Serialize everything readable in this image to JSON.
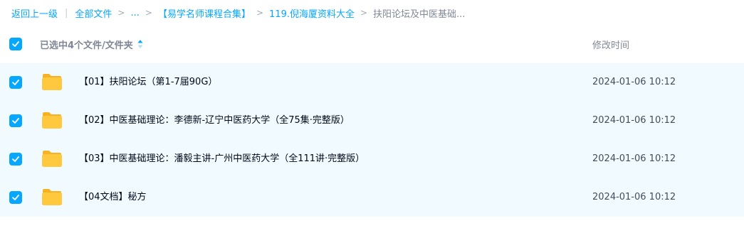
{
  "breadcrumb": {
    "back": "返回上一级",
    "all_files": "全部文件",
    "ellipsis": "...",
    "collection": "【易学名师课程合集】",
    "folder": "119.倪海厦资料大全",
    "current": "扶阳论坛及中医基础..."
  },
  "header": {
    "selection_label": "已选中4个文件/文件夹",
    "time_label": "修改时间",
    "sort_icon": "sort-arrows-icon",
    "checkbox_icon": "checkmark-icon"
  },
  "rows": [
    {
      "name": "【01】扶阳论坛（第1-7届90G）",
      "modified": "2024-01-06 10:12",
      "checked": true,
      "icon": "folder-icon"
    },
    {
      "name": "【02】中医基础理论：李德新-辽宁中医药大学（全75集·完整版）",
      "modified": "2024-01-06 10:12",
      "checked": true,
      "icon": "folder-icon"
    },
    {
      "name": "【03】中医基础理论：潘毅主讲-广州中医药大学（全111讲·完整版）",
      "modified": "2024-01-06 10:12",
      "checked": true,
      "icon": "folder-icon"
    },
    {
      "name": "【04文档】秘方",
      "modified": "2024-01-06 10:12",
      "checked": true,
      "icon": "folder-icon"
    }
  ],
  "colors": {
    "accent": "#06a7ff",
    "row_selected_bg": "#f0faff",
    "folder_yellow": "#ffc83d"
  }
}
